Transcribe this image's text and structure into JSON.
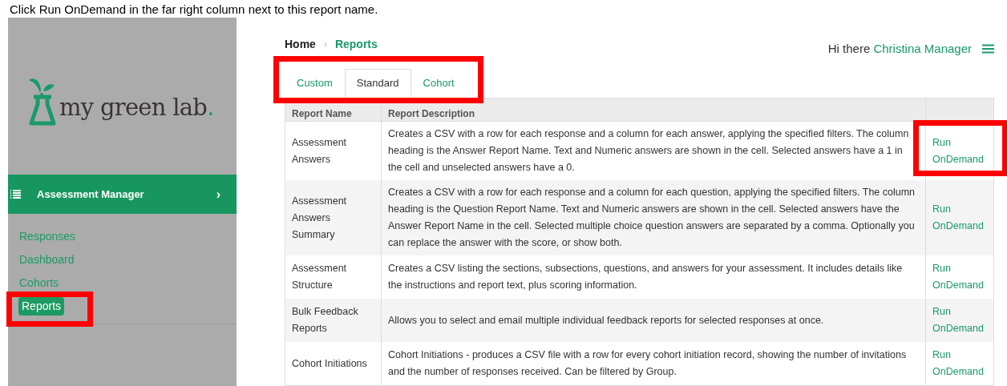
{
  "caption": "Click Run OnDemand in the far right column next to this report name.",
  "sidebar": {
    "logo": {
      "text": "my green lab",
      "dot": "."
    },
    "section": {
      "label": "Assessment Manager",
      "chevron": "›",
      "expanded": true
    },
    "items": [
      {
        "label": "Responses",
        "selected": false,
        "highlighted": false
      },
      {
        "label": "Dashboard",
        "selected": false,
        "highlighted": false
      },
      {
        "label": "Cohorts",
        "selected": false,
        "highlighted": false
      },
      {
        "label": "Reports",
        "selected": true,
        "highlighted": true
      }
    ]
  },
  "breadcrumb": {
    "separator": "›",
    "items": [
      {
        "label": "Home"
      },
      {
        "label": "Reports"
      }
    ]
  },
  "greeting": {
    "text": "Hi there",
    "user": "Christina Manager"
  },
  "tabs": {
    "highlighted": true,
    "items": [
      {
        "label": "Custom",
        "selected": false
      },
      {
        "label": "Standard",
        "selected": true
      },
      {
        "label": "Cohort",
        "selected": false
      }
    ]
  },
  "table": {
    "columns": [
      "Report Name",
      "Report Description"
    ],
    "rows": [
      {
        "name": "Assessment Answers",
        "description": "Creates a CSV with a row for each response and a column for each answer, applying the specified filters. The column heading is the Answer Report Name. Text and Numeric answers are shown in the cell. Selected answers have a 1 in the cell and unselected answers have a 0.",
        "action": "Run OnDemand",
        "highlighted": true
      },
      {
        "name": "Assessment Answers Summary",
        "description": "Creates a CSV with a row for each response and a column for each question, applying the specified filters. The column heading is the Question Report Name. Text and Numeric answers are shown in the cell. Selected answers have the Answer Report Name in the cell. Selected multiple choice question answers are separated by a comma. Optionally you can replace the answer with the score, or show both.",
        "action": "Run OnDemand",
        "highlighted": false
      },
      {
        "name": "Assessment Structure",
        "description": "Creates a CSV listing the sections, subsections, questions, and answers for your assessment. It includes details like the instructions and report text, plus scoring information.",
        "action": "Run OnDemand",
        "highlighted": false
      },
      {
        "name": "Bulk Feedback Reports",
        "description": "Allows you to select and email multiple individual feedback reports for selected responses at once.",
        "action": "Run OnDemand",
        "highlighted": false
      },
      {
        "name": "Cohort Initiations",
        "description": "Cohort Initiations - produces a CSV file with a row for every cohort initiation record, showing the number of invitations and the number of responses received. Can be filtered by Group.",
        "action": "Run OnDemand",
        "highlighted": false
      }
    ]
  }
}
